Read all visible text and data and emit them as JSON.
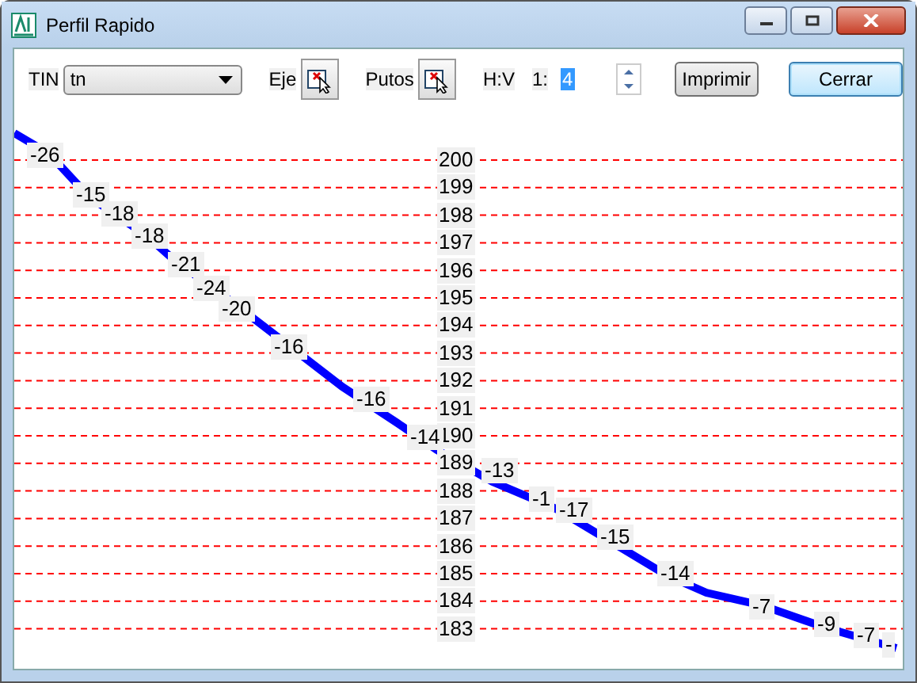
{
  "window": {
    "title": "Perfil Rapido"
  },
  "toolbar": {
    "tin_label": "TIN",
    "tin_value": "tn",
    "eje_label": "Eje",
    "puntos_label": "Putos",
    "hv_label": "H:V",
    "ratio_label": "1:",
    "ratio_value": "4",
    "buttons": [
      {
        "label": "Imprimir",
        "default": false
      },
      {
        "label": "Cerrar",
        "default": true
      }
    ]
  },
  "profile": {
    "elevation_labels": [
      "200",
      "199",
      "198",
      "197",
      "196",
      "195",
      "194",
      "193",
      "192",
      "191",
      "190",
      "189",
      "188",
      "187",
      "186",
      "185",
      "184",
      "183"
    ],
    "slope_labels": [
      "-26",
      "-15",
      "-18",
      "-18",
      "-21",
      "-24",
      "-20",
      "-16",
      "-16",
      "-14",
      "-13",
      "-1",
      "-17",
      "-15",
      "-14",
      "-7",
      "-9",
      "-7",
      "-"
    ]
  }
}
